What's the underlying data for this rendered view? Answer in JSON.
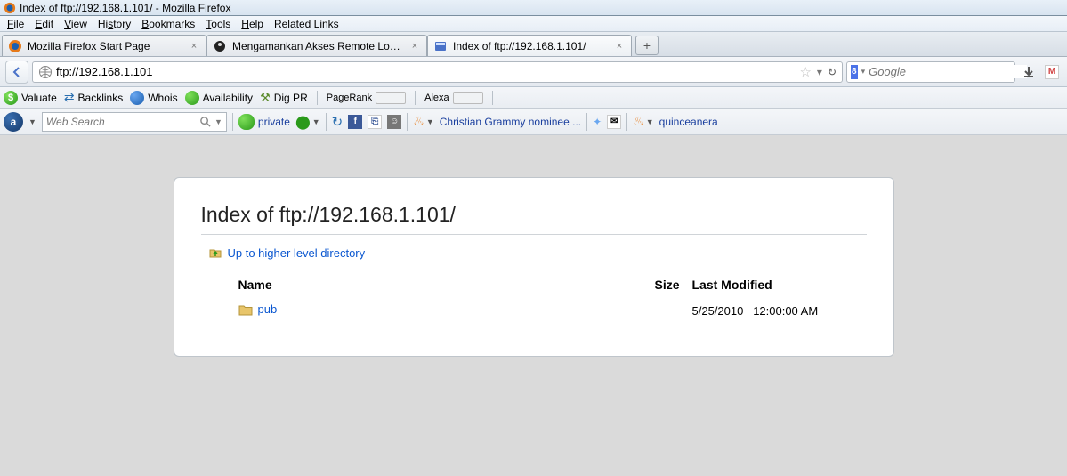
{
  "window": {
    "title": "Index of ftp://192.168.1.101/ - Mozilla Firefox"
  },
  "menu": [
    "File",
    "Edit",
    "View",
    "History",
    "Bookmarks",
    "Tools",
    "Help",
    "Related Links"
  ],
  "tabs": [
    {
      "label": "Mozilla Firefox Start Page",
      "active": false
    },
    {
      "label": "Mengamankan Akses Remote Login s...",
      "active": false
    },
    {
      "label": "Index of ftp://192.168.1.101/",
      "active": true
    }
  ],
  "url": {
    "value": "ftp://192.168.1.101"
  },
  "search": {
    "engine_badge": "8",
    "placeholder": "Google"
  },
  "seo_bar": {
    "items": [
      "Valuate",
      "Backlinks",
      "Whois",
      "Availability",
      "Dig PR"
    ],
    "pills": [
      "PageRank",
      "Alexa"
    ]
  },
  "tool_bar": {
    "web_search_placeholder": "Web Search",
    "private_label": "private",
    "link1": "Christian Grammy nominee ...",
    "link2": "quinceanera"
  },
  "page": {
    "heading": "Index of ftp://192.168.1.101/",
    "up_link": "Up to higher level directory",
    "columns": {
      "name": "Name",
      "size": "Size",
      "modified": "Last Modified"
    },
    "rows": [
      {
        "name": "pub",
        "size": "",
        "date": "5/25/2010",
        "time": "12:00:00 AM"
      }
    ]
  }
}
